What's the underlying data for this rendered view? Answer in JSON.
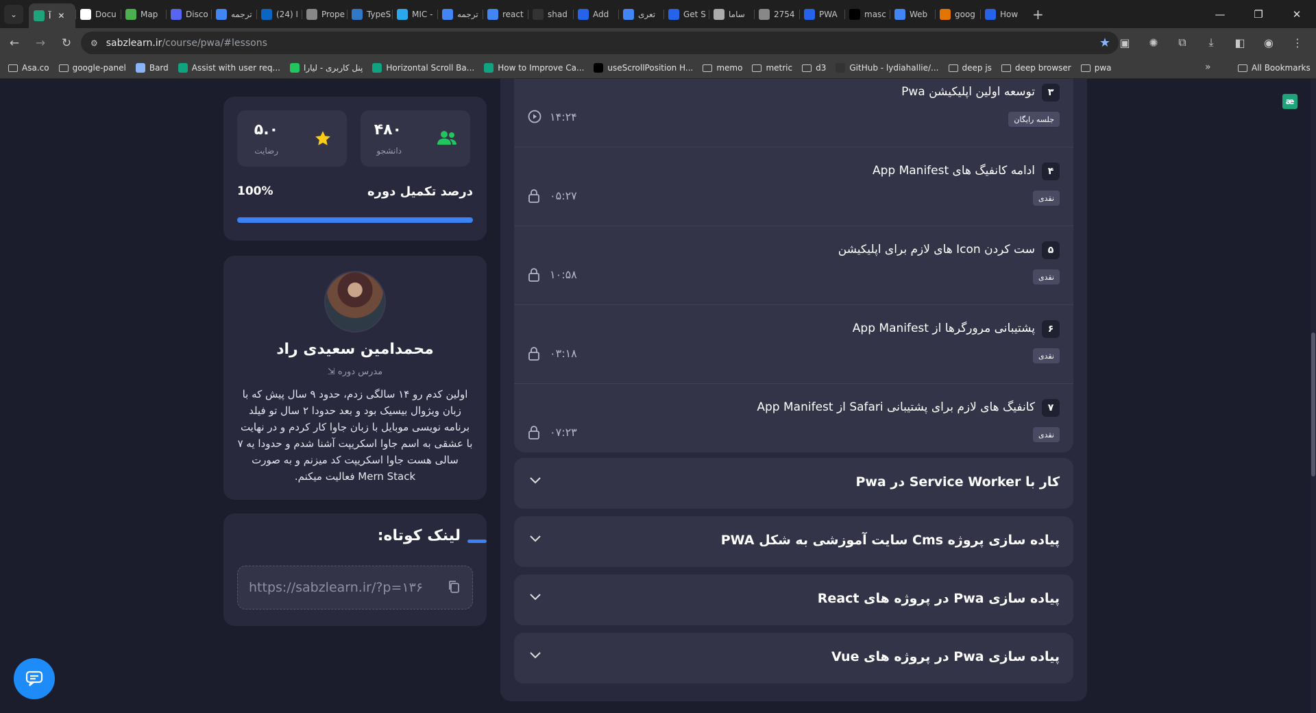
{
  "browser": {
    "tabs": [
      {
        "label": "آ",
        "color": "#1fa37a",
        "active": true
      },
      {
        "label": "Docu",
        "color": "#ffffff"
      },
      {
        "label": "Map",
        "color": "#4caf50"
      },
      {
        "label": "Disco",
        "color": "#5865f2"
      },
      {
        "label": "ترجمه",
        "color": "#4285f4"
      },
      {
        "label": "(24) ا",
        "color": "#0a66c2"
      },
      {
        "label": "Prope",
        "color": "#888888"
      },
      {
        "label": "TypeS",
        "color": "#3178c6"
      },
      {
        "label": "MIC -",
        "color": "#29a9eb"
      },
      {
        "label": "ترجمه",
        "color": "#4285f4"
      },
      {
        "label": "react",
        "color": "#4285f4"
      },
      {
        "label": "shad",
        "color": "#333333"
      },
      {
        "label": "Add",
        "color": "#2563eb"
      },
      {
        "label": "تعری",
        "color": "#4285f4"
      },
      {
        "label": "Get S",
        "color": "#2563eb"
      },
      {
        "label": "ساما",
        "color": "#aaaaaa"
      },
      {
        "label": "2754",
        "color": "#888888"
      },
      {
        "label": "PWA",
        "color": "#2563eb"
      },
      {
        "label": "masc",
        "color": "#000000"
      },
      {
        "label": "Web",
        "color": "#4285f4"
      },
      {
        "label": "goog",
        "color": "#e37400"
      },
      {
        "label": "How",
        "color": "#2563eb"
      }
    ],
    "address": {
      "domain": "sabzlearn.ir",
      "path": "/course/pwa/#lessons"
    },
    "bookmarks": [
      {
        "label": "Asa.co",
        "type": "folder"
      },
      {
        "label": "google-panel",
        "type": "folder"
      },
      {
        "label": "Bard",
        "type": "site",
        "color": "#8ab4f8"
      },
      {
        "label": "Assist with user req...",
        "type": "site",
        "color": "#10a37f"
      },
      {
        "label": "پنل کاربری - لیارا",
        "type": "site",
        "color": "#22c55e"
      },
      {
        "label": "Horizontal Scroll Ba...",
        "type": "site",
        "color": "#10a37f"
      },
      {
        "label": "How to Improve Ca...",
        "type": "site",
        "color": "#10a37f"
      },
      {
        "label": "useScrollPosition H...",
        "type": "site",
        "color": "#000000"
      },
      {
        "label": "memo",
        "type": "folder"
      },
      {
        "label": "metric",
        "type": "folder"
      },
      {
        "label": "d3",
        "type": "folder"
      },
      {
        "label": "GitHub - lydiahallie/...",
        "type": "site",
        "color": "#333333"
      },
      {
        "label": "deep js",
        "type": "folder"
      },
      {
        "label": "deep browser",
        "type": "folder"
      },
      {
        "label": "pwa",
        "type": "folder"
      }
    ],
    "all_bookmarks": "All Bookmarks"
  },
  "stats": {
    "students_value": "۴۸۰",
    "students_label": "دانشجو",
    "rating_value": "۵.۰",
    "rating_label": "رضایت",
    "progress_title": "درصد تکمیل دوره",
    "progress_text": "100%",
    "progress_fraction": 1.0,
    "progress_color": "#3b82f6"
  },
  "teacher": {
    "name": "محمدامین سعیدی راد",
    "role": "مدرس دوره",
    "bio": "اولین کدم رو ۱۴ سالگی زدم، حدود ۹ سال پیش که با زبان ویژوال بیسیک بود و بعد حدودا ۲ سال تو فیلد برنامه نویسی موبایل با زبان جاوا کار کردم و در نهایت با عشقی به اسم جاوا اسکریپت آشنا شدم و حدودا یه ۷ سالی هست جاوا اسکریپت کد میزنم و به صورت Mern Stack فعالیت میکنم."
  },
  "short_link": {
    "title": "لینک کوتاه:",
    "url": "https://sabzlearn.ir/?p=۱۳۶"
  },
  "lessons": [
    {
      "num": "۳",
      "title": "توسعه اولین اپلیکیشن Pwa",
      "tag": "جلسه رایگان",
      "time": "۱۴:۲۴",
      "locked": false
    },
    {
      "num": "۴",
      "title": "ادامه کانفیگ های App Manifest",
      "tag": "نقدی",
      "time": "۰۵:۲۷",
      "locked": true
    },
    {
      "num": "۵",
      "title": "ست کردن Icon های لازم برای اپلیکیشن",
      "tag": "نقدی",
      "time": "۱۰:۵۸",
      "locked": true
    },
    {
      "num": "۶",
      "title": "پشتیبانی مرورگرها از App Manifest",
      "tag": "نقدی",
      "time": "۰۳:۱۸",
      "locked": true
    },
    {
      "num": "۷",
      "title": "کانفیگ های لازم برای پشتیبانی Safari از App Manifest",
      "tag": "نقدی",
      "time": "۰۷:۲۳",
      "locked": true
    }
  ],
  "sections": [
    {
      "title": "کار با Service Worker در Pwa"
    },
    {
      "title": "پیاده سازی پروژه Cms سایت آموزشی به شکل PWA"
    },
    {
      "title": "پیاده سازی Pwa در پروژه های React"
    },
    {
      "title": "پیاده سازی Pwa در پروژه های Vue"
    }
  ]
}
